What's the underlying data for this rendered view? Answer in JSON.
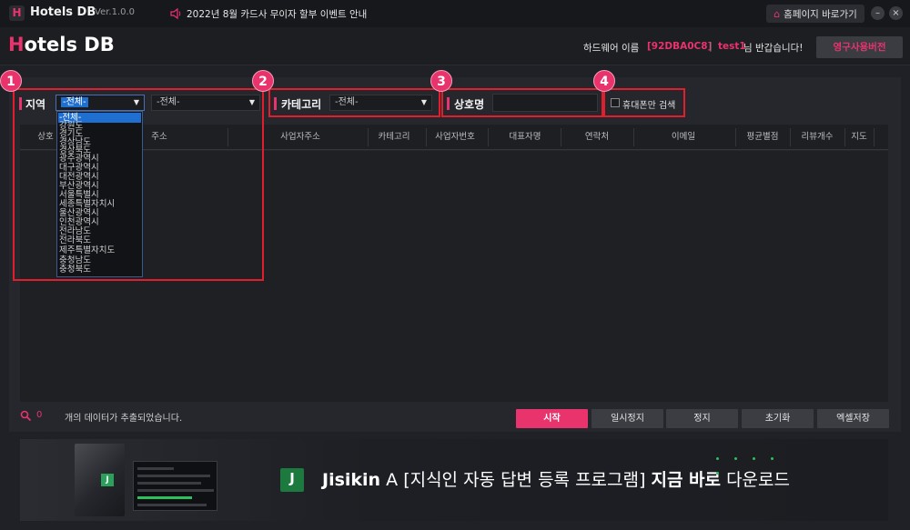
{
  "titlebar": {
    "app_icon": "H",
    "app_title": "Hotels DB",
    "version": "Ver.1.0.0",
    "notice": "2022년 8월 카드사 무이자 할부 이벤트 안내",
    "homepage_button": "홈페이지 바로가기",
    "minimize": "–",
    "close": "×"
  },
  "header": {
    "logo_h": "H",
    "logo_rest": "otels DB",
    "hardware_label": "하드웨어 이름",
    "hardware_value": "[92DBA0C8]",
    "separator": "|",
    "user_id": "test1",
    "welcome": "님 반갑습니다!",
    "license_button": "영구사용버전"
  },
  "filters": {
    "region_label": "지역",
    "region_value": "-전체-",
    "district_value": "-전체-",
    "category_label": "카테고리",
    "category_value": "-전체-",
    "bizname_label": "상호명",
    "bizname_value": "",
    "closed_only_label": "휴대폰만 검색"
  },
  "annotations": [
    "1",
    "2",
    "3",
    "4"
  ],
  "region_options": [
    "-전체-",
    "강원도",
    "경기도",
    "경상남도",
    "경상북도",
    "광주광역시",
    "대구광역시",
    "대전광역시",
    "부산광역시",
    "서울특별시",
    "세종특별자치시",
    "울산광역시",
    "인천광역시",
    "전라남도",
    "전라북도",
    "제주특별자치도",
    "충청남도",
    "충청북도"
  ],
  "table": {
    "columns": [
      "상호",
      "주소",
      "사업자주소",
      "카테고리",
      "사업자번호",
      "대표자명",
      "연락처",
      "이메일",
      "평균별점",
      "리뷰개수",
      "지도"
    ]
  },
  "status": {
    "count": "0",
    "text": "개의 데이터가 추출되었습니다."
  },
  "buttons": {
    "start": "시작",
    "pause": "일시정지",
    "stop": "정지",
    "reset": "초기화",
    "excel": "엑셀저장"
  },
  "banner": {
    "box_logo": "J",
    "logo_letter": "J",
    "brand": "Jisikin",
    "brand_suffix": "A",
    "description": "[지식인 자동 답변 등록 프로그램]",
    "cta_bold": "지금 바로",
    "cta_rest": "다운로드"
  },
  "colors": {
    "accent": "#e8336d",
    "annotation_red": "#e01e2e",
    "background": "#1f2126"
  }
}
